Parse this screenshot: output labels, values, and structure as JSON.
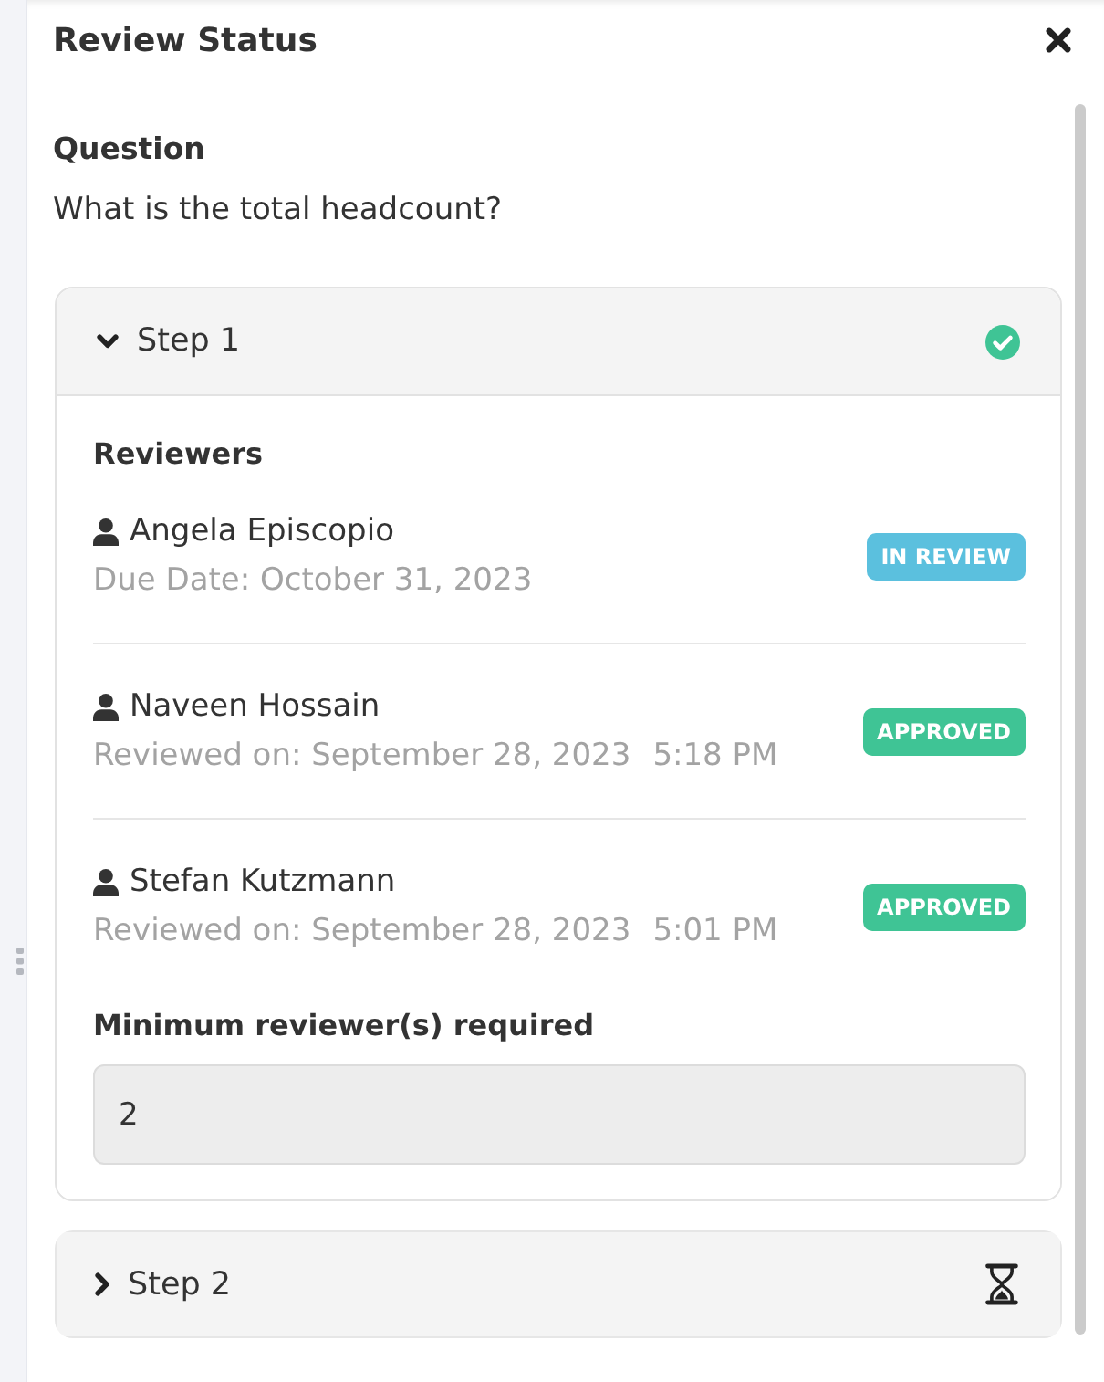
{
  "panel": {
    "title": "Review Status"
  },
  "question": {
    "label": "Question",
    "text": "What is the total headcount?"
  },
  "steps": [
    {
      "label": "Step 1",
      "expanded": true,
      "completed": true,
      "reviewers_heading": "Reviewers",
      "reviewers": [
        {
          "name": "Angela Episcopio",
          "detail": "Due Date: October 31, 2023",
          "badge": {
            "label": "IN REVIEW",
            "color": "#5bc0de"
          }
        },
        {
          "name": "Naveen Hossain",
          "detail": "Reviewed on: September 28, 2023",
          "time": "5:18 PM",
          "badge": {
            "label": "APPROVED",
            "color": "#3fc495"
          }
        },
        {
          "name": "Stefan Kutzmann",
          "detail": "Reviewed on: September 28, 2023",
          "time": "5:01 PM",
          "badge": {
            "label": "APPROVED",
            "color": "#3fc495"
          }
        }
      ],
      "minimum": {
        "label": "Minimum reviewer(s) required",
        "value": "2",
        "disabled": true
      }
    },
    {
      "label": "Step 2",
      "expanded": false,
      "completed": false
    }
  ]
}
